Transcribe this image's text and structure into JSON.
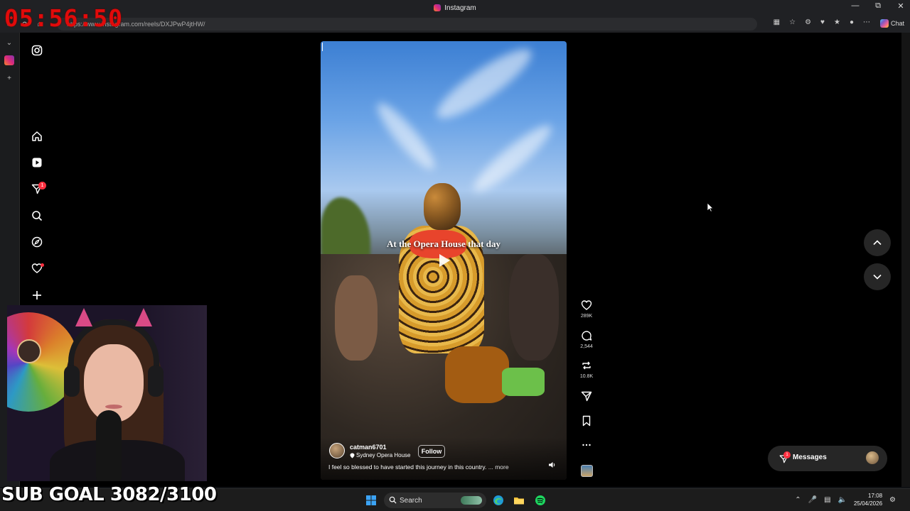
{
  "window": {
    "title": "Instagram",
    "controls": [
      "minimize",
      "restore",
      "close"
    ]
  },
  "address_bar": {
    "url": "https://www.instagram.com/reels/DXJPwP4jtHW/",
    "chat_label": "Chat"
  },
  "overlay": {
    "clock": "05:56:50",
    "sub_goal": "SUB GOAL 3082/3100"
  },
  "instagram": {
    "sidebar": {
      "items": [
        "instagram-logo",
        "home",
        "reels",
        "messages",
        "search",
        "explore",
        "notifications",
        "create"
      ],
      "messages_badge": "1"
    },
    "reel": {
      "overlay_caption": "At the Opera House that day",
      "username": "catman6701",
      "location": "Sydney Opera House",
      "follow_label": "Follow",
      "caption": "I feel so blessed to have started this journey in this country.",
      "more_label": "... more"
    },
    "actions": {
      "likes": "289K",
      "comments": "2,544",
      "reposts": "10.8K"
    },
    "messages_pill": {
      "label": "Messages",
      "badge": "1"
    }
  },
  "taskbar": {
    "search_placeholder": "Search",
    "time": "17:08",
    "date": "25/04/2026"
  }
}
